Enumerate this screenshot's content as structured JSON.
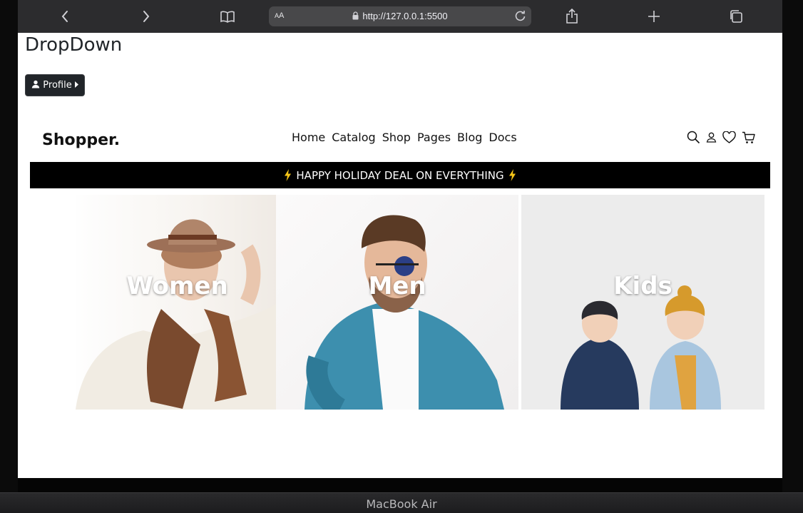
{
  "device": {
    "bottom_label": "MacBook Air"
  },
  "browser": {
    "text_size_label": "AA",
    "url": "http://127.0.0.1:5500",
    "icons": [
      "chevron-left-icon",
      "chevron-right-icon",
      "book-icon",
      "share-icon",
      "plus-icon",
      "tabs-icon",
      "lock-icon",
      "reload-icon"
    ]
  },
  "page": {
    "dropdown_title": "DropDown",
    "profile_button": "Profile",
    "brand": "Shopper.",
    "nav": [
      "Home",
      "Catalog",
      "Shop",
      "Pages",
      "Blog",
      "Docs"
    ],
    "nav_icons": [
      "search-icon",
      "user-icon",
      "heart-icon",
      "cart-icon"
    ],
    "promo": "HAPPY HOLIDAY DEAL ON EVERYTHING",
    "promo_accent": "#f5c518",
    "categories": [
      "Women",
      "Men",
      "Kids"
    ]
  }
}
